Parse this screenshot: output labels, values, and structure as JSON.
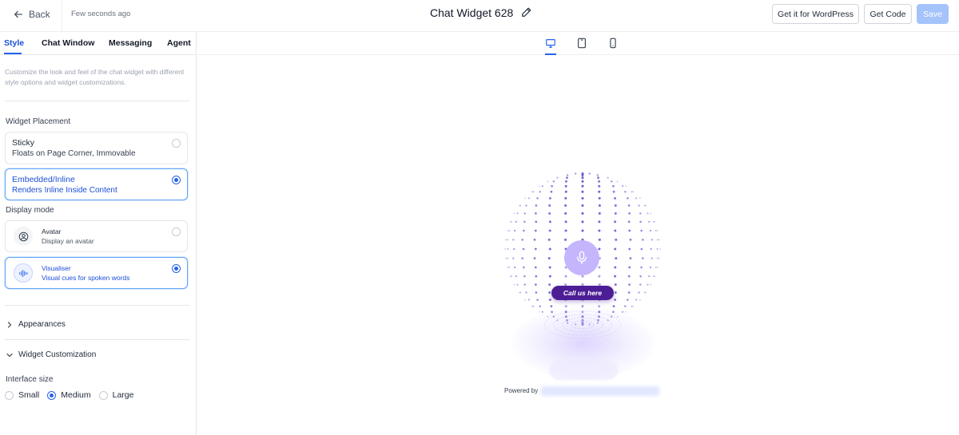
{
  "header": {
    "back_label": "Back",
    "status": "Few seconds ago",
    "title": "Chat Widget 628",
    "buttons": {
      "wordpress": "Get it for WordPress",
      "code": "Get Code",
      "save": "Save"
    }
  },
  "sidebar": {
    "tabs": [
      {
        "label": "Style",
        "active": true
      },
      {
        "label": "Chat Window",
        "active": false
      },
      {
        "label": "Messaging",
        "active": false
      },
      {
        "label": "Agent",
        "active": false
      }
    ],
    "description": "Customize the look and feel of the chat widget with different style options and widget customizations.",
    "placement": {
      "label": "Widget Placement",
      "options": [
        {
          "title": "Sticky",
          "subtitle": "Floats on Page Corner, Immovable",
          "selected": false
        },
        {
          "title": "Embedded/Inline",
          "subtitle": "Renders Inline Inside Content",
          "selected": true
        }
      ]
    },
    "display_mode": {
      "label": "Display mode",
      "options": [
        {
          "title": "Avatar",
          "subtitle": "Display an avatar",
          "icon": "avatar-icon",
          "selected": false
        },
        {
          "title": "Visualiser",
          "subtitle": "Visual cues for spoken words",
          "icon": "waveform-icon",
          "selected": true
        }
      ]
    },
    "sections": {
      "appearances": {
        "label": "Appearances",
        "expanded": false
      },
      "customization": {
        "label": "Widget Customization",
        "expanded": true
      }
    },
    "interface_size": {
      "label": "Interface size",
      "options": [
        "Small",
        "Medium",
        "Large"
      ],
      "selected": "Medium"
    }
  },
  "preview": {
    "devices": [
      "desktop-icon",
      "tablet-icon",
      "mobile-icon"
    ],
    "active_device": "desktop",
    "call_label": "Call us here",
    "powered_by": "Powered by"
  },
  "colors": {
    "accent": "#2563eb",
    "save_disabled": "#a5c3fb",
    "dots": "#6d5bd0",
    "mic_bg": "#c4b5fd",
    "call_pill": "#4c1d95"
  }
}
